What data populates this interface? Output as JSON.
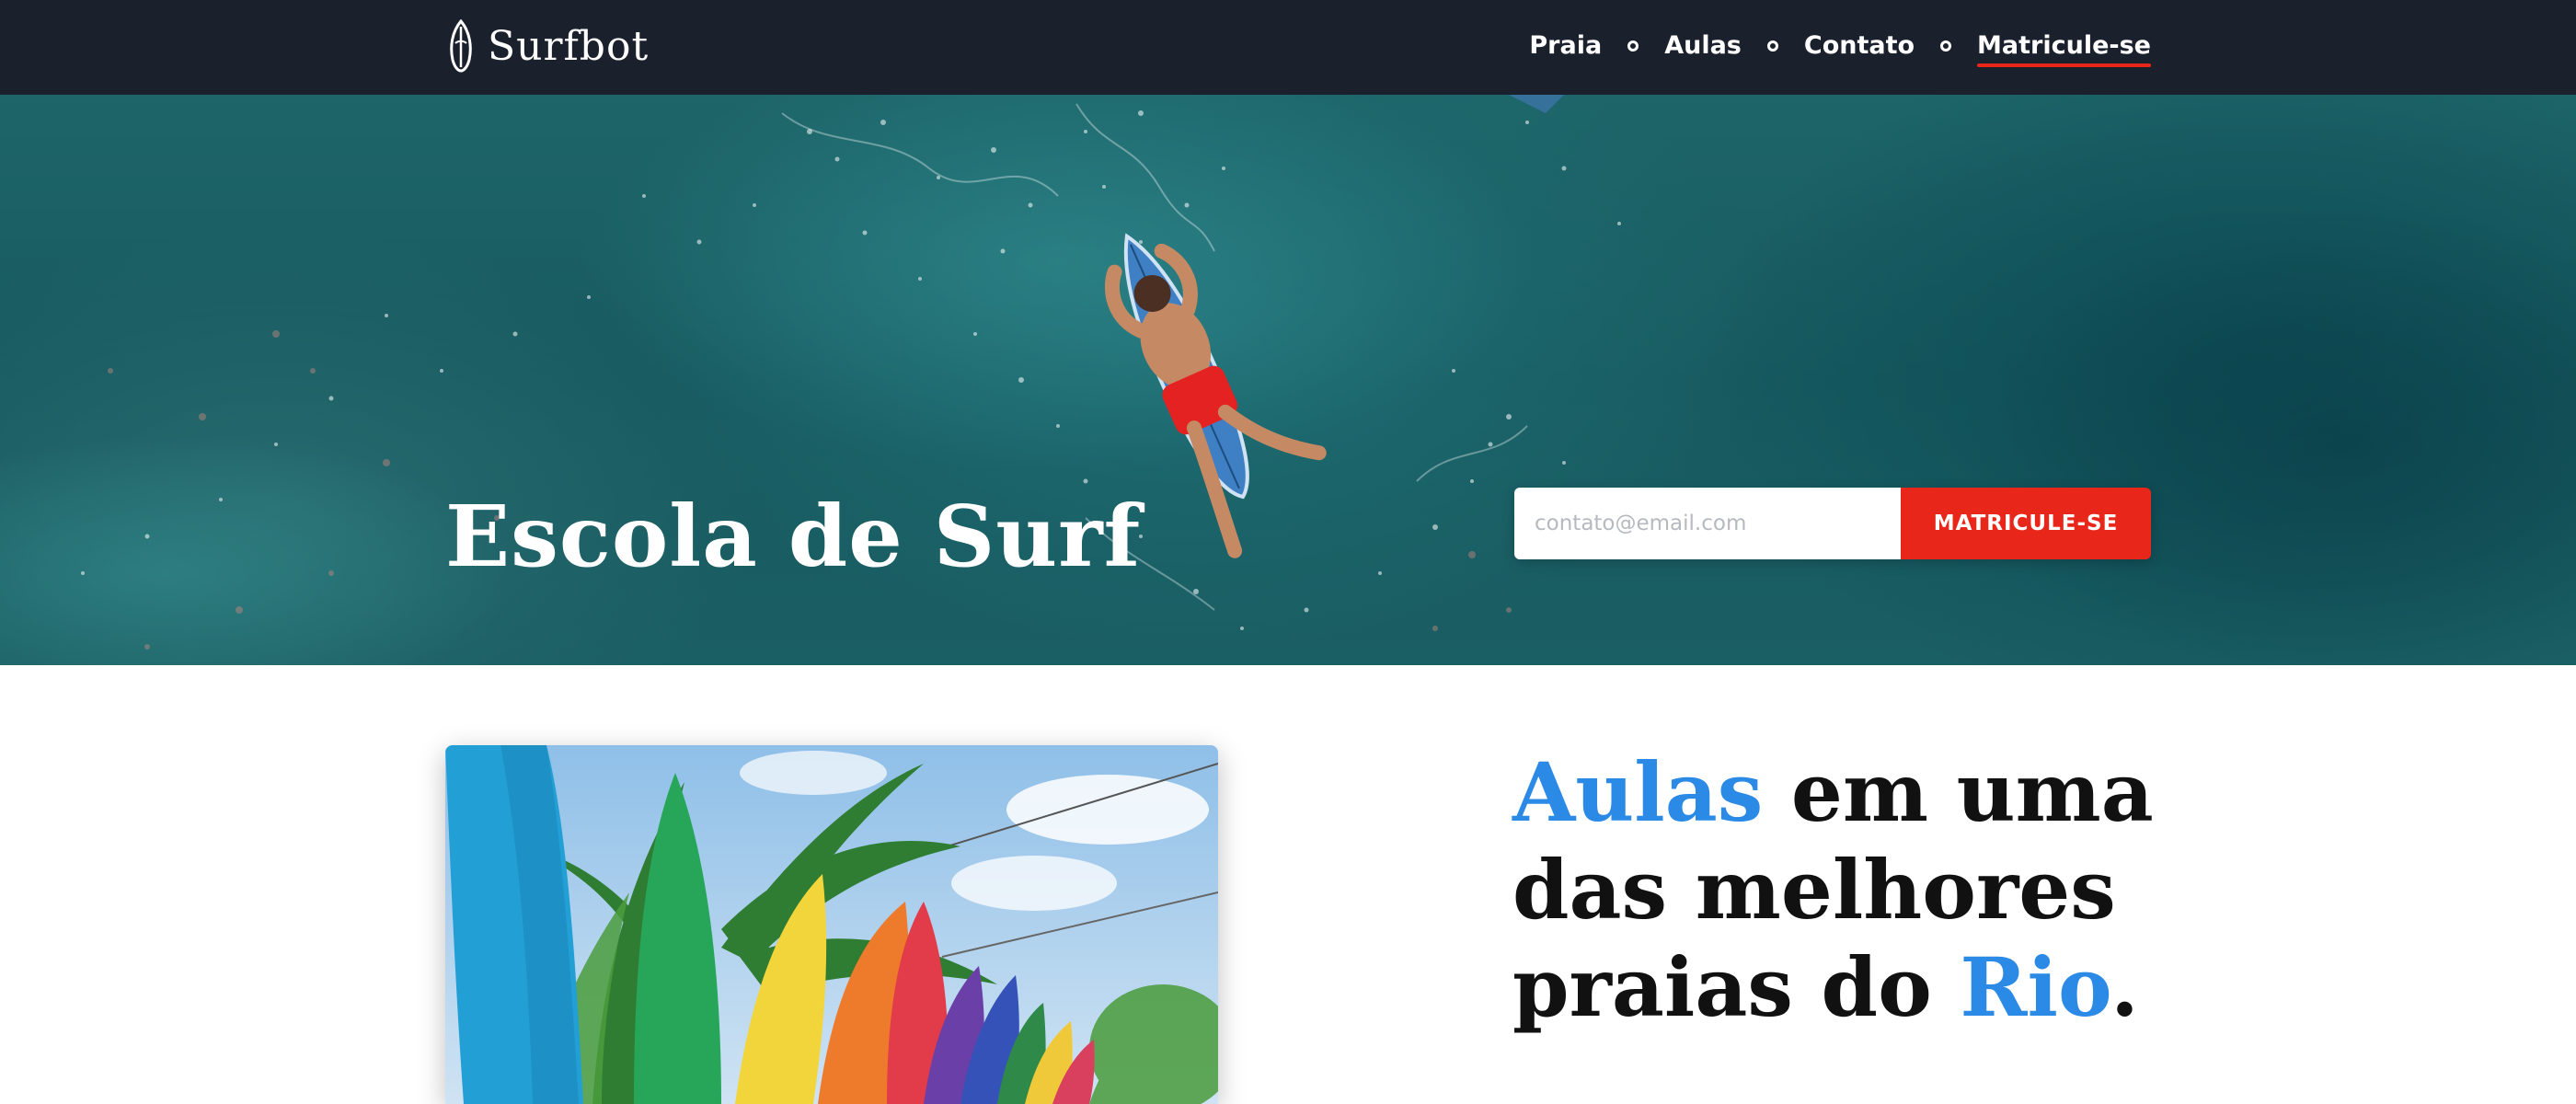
{
  "header": {
    "brand": "Surfbot",
    "nav": [
      {
        "label": "Praia",
        "active": false
      },
      {
        "label": "Aulas",
        "active": false
      },
      {
        "label": "Contato",
        "active": false
      },
      {
        "label": "Matricule-se",
        "active": true
      }
    ]
  },
  "hero": {
    "title": "Escola de Surf",
    "signup": {
      "placeholder": "contato@email.com",
      "button_label": "MATRICULE-SE"
    }
  },
  "section": {
    "headline": {
      "word_accent_1": "Aulas",
      "text_1": " em uma",
      "line_2": "das melhores",
      "text_3": "praias do ",
      "word_accent_2": "Rio",
      "period": "."
    }
  },
  "colors": {
    "header_bg": "#1b202d",
    "accent_red": "#e9261a",
    "accent_blue": "#2a8ae6",
    "hero_water": "#1a5f64"
  },
  "icons": {
    "logo": "surfboard-icon",
    "nav_separator": "circle-dot-icon"
  }
}
